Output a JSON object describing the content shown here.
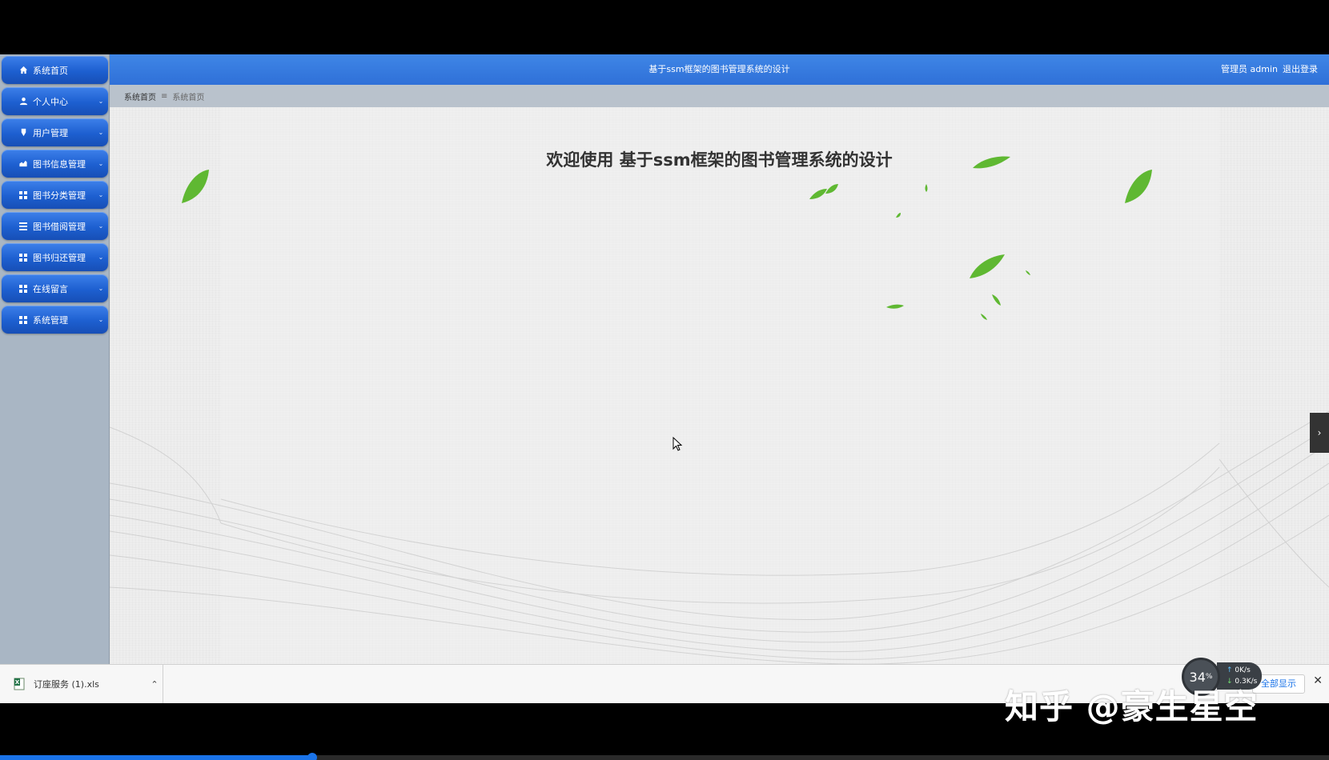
{
  "sidebar": {
    "items": [
      {
        "label": "系统首页",
        "icon": "home-icon",
        "has_children": false
      },
      {
        "label": "个人中心",
        "icon": "user-icon",
        "has_children": true
      },
      {
        "label": "用户管理",
        "icon": "users-icon",
        "has_children": true
      },
      {
        "label": "图书信息管理",
        "icon": "book-icon",
        "has_children": true
      },
      {
        "label": "图书分类管理",
        "icon": "grid-icon",
        "has_children": true
      },
      {
        "label": "图书借阅管理",
        "icon": "list-icon",
        "has_children": true
      },
      {
        "label": "图书归还管理",
        "icon": "grid-icon",
        "has_children": true
      },
      {
        "label": "在线留言",
        "icon": "grid-icon",
        "has_children": true
      },
      {
        "label": "系统管理",
        "icon": "grid-icon",
        "has_children": true
      }
    ]
  },
  "header": {
    "title": "基于ssm框架的图书管理系统的设计",
    "user_label": "管理员 admin",
    "logout_label": "退出登录"
  },
  "breadcrumb": {
    "root": "系统首页",
    "separator": "≡",
    "current": "系统首页"
  },
  "main": {
    "welcome": "欢迎使用 基于ssm框架的图书管理系统的设计"
  },
  "download_bar": {
    "file_name": "订座服务 (1).xls",
    "show_all_label": "全部显示"
  },
  "net_monitor": {
    "percent": "34",
    "percent_unit": "%",
    "upload": "0",
    "download": "0.3",
    "unit": "K/s"
  },
  "watermark": "知乎 @豪生星空",
  "video_progress": 0.235,
  "colors": {
    "nav_blue": "#1d5fd0",
    "header_blue": "#3f86e6",
    "leaf_green": "#5fb832"
  }
}
